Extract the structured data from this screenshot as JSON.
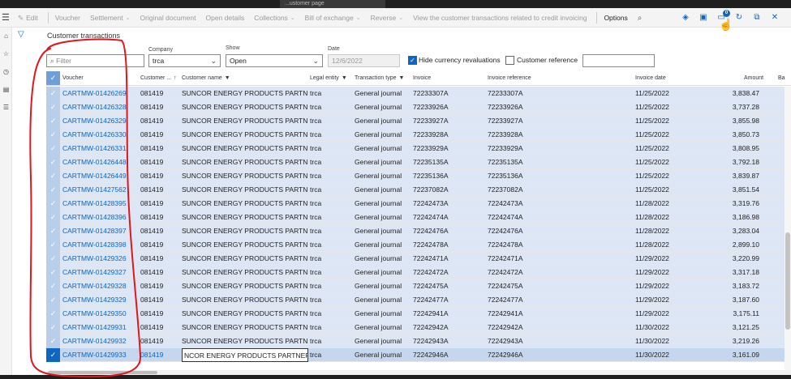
{
  "topbar": {
    "search_text": "...ustomer page"
  },
  "actionbar": {
    "items": [
      {
        "label": "Edit",
        "icon": "pencil-icon"
      },
      {
        "label": "Voucher"
      },
      {
        "label": "Settlement",
        "dropdown": true
      },
      {
        "label": "Original document"
      },
      {
        "label": "Open details"
      },
      {
        "label": "Collections",
        "dropdown": true
      },
      {
        "label": "Bill of exchange",
        "dropdown": true
      },
      {
        "label": "Reverse",
        "dropdown": true
      },
      {
        "label": "View the customer transactions related to credit invoicing"
      },
      {
        "label": "Options",
        "active": true
      }
    ],
    "badge_count": "0"
  },
  "page": {
    "title": "Customer transactions"
  },
  "filters": {
    "filter_placeholder": "Filter",
    "company_label": "Company",
    "company_value": "trca",
    "show_label": "Show",
    "show_value": "Open",
    "date_label": "Date",
    "date_value": "12/6/2022",
    "hide_currency_label": "Hide currency revaluations",
    "hide_currency_checked": true,
    "customer_reference_label": "Customer reference",
    "customer_reference_checked": false,
    "customer_reference_value": ""
  },
  "grid": {
    "columns": [
      "Voucher",
      "Customer ...",
      "Customer name",
      "Legal entity",
      "Transaction type",
      "Invoice",
      "Invoice reference",
      "Invoice date",
      "Amount",
      "Ba"
    ],
    "rows": [
      {
        "voucher": "CARTMW-01426269",
        "customer": "081419",
        "name": "SUNCOR ENERGY PRODUCTS PARTNER...",
        "entity": "trca",
        "type": "General journal",
        "invoice": "72233307A",
        "ref": "72233307A",
        "date": "11/25/2022",
        "amount": "3,838.47"
      },
      {
        "voucher": "CARTMW-01426328",
        "customer": "081419",
        "name": "SUNCOR ENERGY PRODUCTS PARTNER...",
        "entity": "trca",
        "type": "General journal",
        "invoice": "72233926A",
        "ref": "72233926A",
        "date": "11/25/2022",
        "amount": "3,737.28"
      },
      {
        "voucher": "CARTMW-01426329",
        "customer": "081419",
        "name": "SUNCOR ENERGY PRODUCTS PARTNER...",
        "entity": "trca",
        "type": "General journal",
        "invoice": "72233927A",
        "ref": "72233927A",
        "date": "11/25/2022",
        "amount": "3,855.98"
      },
      {
        "voucher": "CARTMW-01426330",
        "customer": "081419",
        "name": "SUNCOR ENERGY PRODUCTS PARTNER...",
        "entity": "trca",
        "type": "General journal",
        "invoice": "72233928A",
        "ref": "72233928A",
        "date": "11/25/2022",
        "amount": "3,850.73"
      },
      {
        "voucher": "CARTMW-01426331",
        "customer": "081419",
        "name": "SUNCOR ENERGY PRODUCTS PARTNER...",
        "entity": "trca",
        "type": "General journal",
        "invoice": "72233929A",
        "ref": "72233929A",
        "date": "11/25/2022",
        "amount": "3,808.95"
      },
      {
        "voucher": "CARTMW-01426448",
        "customer": "081419",
        "name": "SUNCOR ENERGY PRODUCTS PARTNER...",
        "entity": "trca",
        "type": "General journal",
        "invoice": "72235135A",
        "ref": "72235135A",
        "date": "11/25/2022",
        "amount": "3,792.18"
      },
      {
        "voucher": "CARTMW-01426449",
        "customer": "081419",
        "name": "SUNCOR ENERGY PRODUCTS PARTNER...",
        "entity": "trca",
        "type": "General journal",
        "invoice": "72235136A",
        "ref": "72235136A",
        "date": "11/25/2022",
        "amount": "3,839.87"
      },
      {
        "voucher": "CARTMW-01427562",
        "customer": "081419",
        "name": "SUNCOR ENERGY PRODUCTS PARTNER...",
        "entity": "trca",
        "type": "General journal",
        "invoice": "72237082A",
        "ref": "72237082A",
        "date": "11/25/2022",
        "amount": "3,851.54"
      },
      {
        "voucher": "CARTMW-01428395",
        "customer": "081419",
        "name": "SUNCOR ENERGY PRODUCTS PARTNER...",
        "entity": "trca",
        "type": "General journal",
        "invoice": "72242473A",
        "ref": "72242473A",
        "date": "11/28/2022",
        "amount": "3,319.76"
      },
      {
        "voucher": "CARTMW-01428396",
        "customer": "081419",
        "name": "SUNCOR ENERGY PRODUCTS PARTNER...",
        "entity": "trca",
        "type": "General journal",
        "invoice": "72242474A",
        "ref": "72242474A",
        "date": "11/28/2022",
        "amount": "3,186.98"
      },
      {
        "voucher": "CARTMW-01428397",
        "customer": "081419",
        "name": "SUNCOR ENERGY PRODUCTS PARTNER...",
        "entity": "trca",
        "type": "General journal",
        "invoice": "72242476A",
        "ref": "72242476A",
        "date": "11/28/2022",
        "amount": "3,283.04"
      },
      {
        "voucher": "CARTMW-01428398",
        "customer": "081419",
        "name": "SUNCOR ENERGY PRODUCTS PARTNER...",
        "entity": "trca",
        "type": "General journal",
        "invoice": "72242478A",
        "ref": "72242478A",
        "date": "11/28/2022",
        "amount": "2,899.10"
      },
      {
        "voucher": "CARTMW-01429326",
        "customer": "081419",
        "name": "SUNCOR ENERGY PRODUCTS PARTNER...",
        "entity": "trca",
        "type": "General journal",
        "invoice": "72242471A",
        "ref": "72242471A",
        "date": "11/29/2022",
        "amount": "3,220.99"
      },
      {
        "voucher": "CARTMW-01429327",
        "customer": "081419",
        "name": "SUNCOR ENERGY PRODUCTS PARTNER...",
        "entity": "trca",
        "type": "General journal",
        "invoice": "72242472A",
        "ref": "72242472A",
        "date": "11/29/2022",
        "amount": "3,317.18"
      },
      {
        "voucher": "CARTMW-01429328",
        "customer": "081419",
        "name": "SUNCOR ENERGY PRODUCTS PARTNER...",
        "entity": "trca",
        "type": "General journal",
        "invoice": "72242475A",
        "ref": "72242475A",
        "date": "11/29/2022",
        "amount": "3,183.72"
      },
      {
        "voucher": "CARTMW-01429329",
        "customer": "081419",
        "name": "SUNCOR ENERGY PRODUCTS PARTNER...",
        "entity": "trca",
        "type": "General journal",
        "invoice": "72242477A",
        "ref": "72242477A",
        "date": "11/29/2022",
        "amount": "3,187.60"
      },
      {
        "voucher": "CARTMW-01429350",
        "customer": "081419",
        "name": "SUNCOR ENERGY PRODUCTS PARTNER...",
        "entity": "trca",
        "type": "General journal",
        "invoice": "72242941A",
        "ref": "72242941A",
        "date": "11/29/2022",
        "amount": "3,175.11"
      },
      {
        "voucher": "CARTMW-01429931",
        "customer": "081419",
        "name": "SUNCOR ENERGY PRODUCTS PARTNER...",
        "entity": "trca",
        "type": "General journal",
        "invoice": "72242942A",
        "ref": "72242942A",
        "date": "11/30/2022",
        "amount": "3,121.25"
      },
      {
        "voucher": "CARTMW-01429932",
        "customer": "081419",
        "name": "SUNCOR ENERGY PRODUCTS PARTNER...",
        "entity": "trca",
        "type": "General journal",
        "invoice": "72242943A",
        "ref": "72242943A",
        "date": "11/30/2022",
        "amount": "3,219.26"
      },
      {
        "voucher": "CARTMW-01429933",
        "customer": "081419",
        "name": "NCOR ENERGY PRODUCTS PARTNERSHIP",
        "entity": "trca",
        "type": "General journal",
        "invoice": "72242946A",
        "ref": "72242946A",
        "date": "11/30/2022",
        "amount": "3,161.09",
        "current": true
      }
    ]
  },
  "colors": {
    "accent": "#0c66c2",
    "selected_row": "#dce6f4",
    "annotation": "#e0161d"
  }
}
